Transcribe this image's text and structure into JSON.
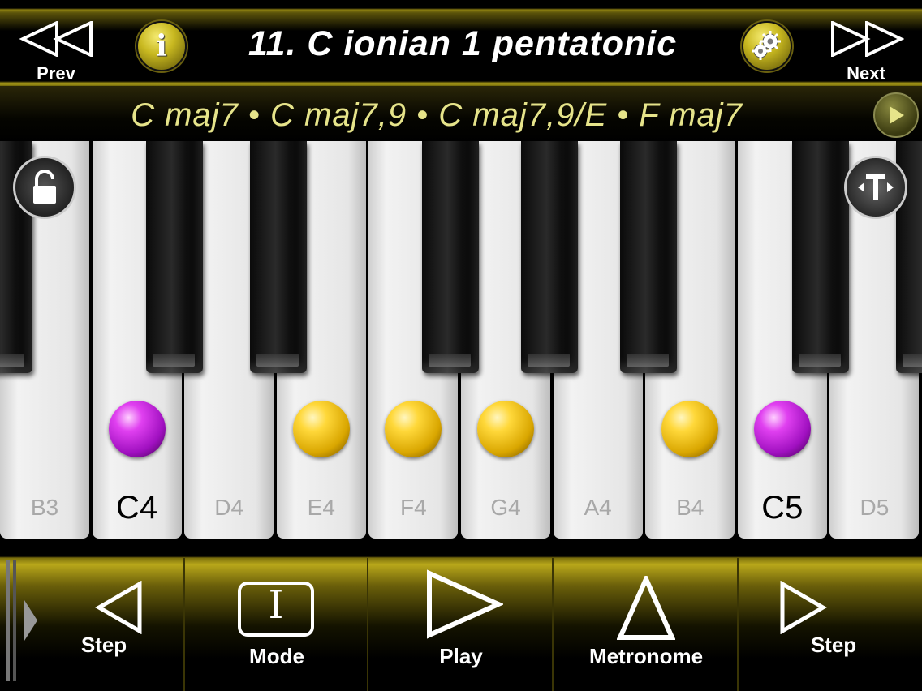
{
  "header": {
    "prev_label": "Prev",
    "next_label": "Next",
    "title": "11. C ionian 1 pentatonic",
    "info_glyph": "i"
  },
  "chords": {
    "text": "C maj7 • C maj7,9 •  C maj7,9/E  • F maj7"
  },
  "keyboard": {
    "keys": [
      {
        "label": "B3",
        "root": false,
        "dot": null
      },
      {
        "label": "C4",
        "root": true,
        "dot": "purple"
      },
      {
        "label": "D4",
        "root": false,
        "dot": null
      },
      {
        "label": "E4",
        "root": false,
        "dot": "yellow"
      },
      {
        "label": "F4",
        "root": false,
        "dot": "yellow"
      },
      {
        "label": "G4",
        "root": false,
        "dot": "yellow"
      },
      {
        "label": "A4",
        "root": false,
        "dot": null
      },
      {
        "label": "B4",
        "root": false,
        "dot": "yellow"
      },
      {
        "label": "C5",
        "root": true,
        "dot": "purple"
      },
      {
        "label": "D5",
        "root": false,
        "dot": null
      }
    ]
  },
  "toolbar": {
    "step_back_label": "Step",
    "mode_label": "Mode",
    "mode_glyph": "I",
    "play_label": "Play",
    "metronome_label": "Metronome",
    "step_forward_label": "Step"
  },
  "colors": {
    "accent_gold": "#c8b820",
    "chord_text": "#e6e48a",
    "note_dot_yellow": "#ffd83a",
    "note_dot_purple": "#e040f0"
  },
  "icons": [
    "rewind-icon",
    "info-icon",
    "gear-icon",
    "fast-forward-icon",
    "play-icon",
    "unlock-icon",
    "transpose-icon",
    "step-back-icon",
    "mode-icon",
    "metronome-icon",
    "step-forward-icon"
  ]
}
